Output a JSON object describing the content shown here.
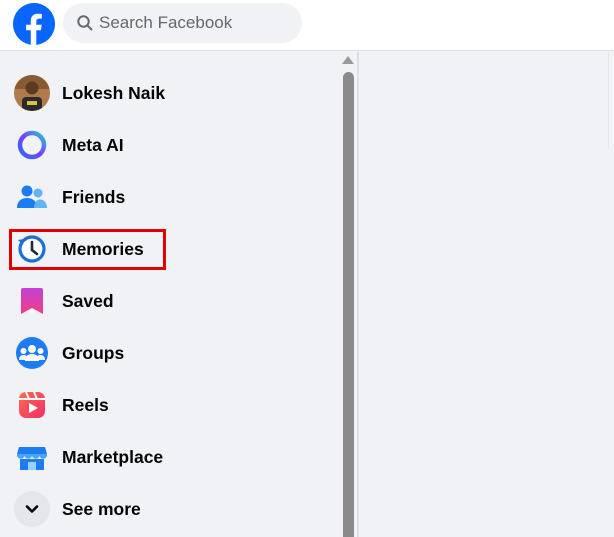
{
  "header": {
    "logo_icon": "facebook-logo-icon",
    "brand_color": "#0866ff",
    "search": {
      "placeholder": "Search Facebook",
      "value": "",
      "icon": "search-icon"
    }
  },
  "sidebar": {
    "items": [
      {
        "label": "Lokesh Naik",
        "icon": "profile-avatar"
      },
      {
        "label": "Meta AI",
        "icon": "meta-ai-ring-icon"
      },
      {
        "label": "Friends",
        "icon": "friends-icon"
      },
      {
        "label": "Memories",
        "icon": "memories-clock-icon",
        "highlighted": true,
        "highlight_color": "#e00000"
      },
      {
        "label": "Saved",
        "icon": "saved-bookmark-icon"
      },
      {
        "label": "Groups",
        "icon": "groups-icon"
      },
      {
        "label": "Reels",
        "icon": "reels-icon"
      },
      {
        "label": "Marketplace",
        "icon": "marketplace-shop-icon"
      },
      {
        "label": "See more",
        "icon": "chevron-down-icon"
      }
    ]
  }
}
